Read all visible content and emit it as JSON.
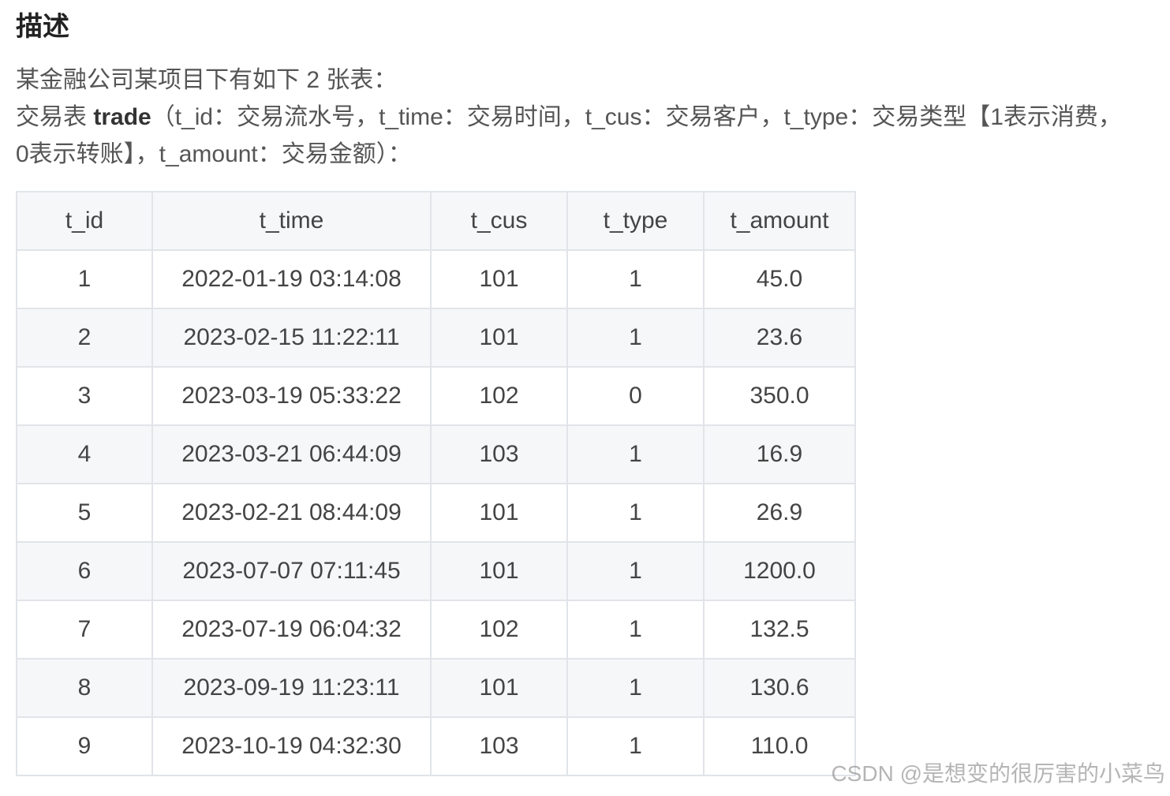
{
  "heading": "描述",
  "intro": {
    "line1": "某金融公司某项目下有如下 2 张表：",
    "line2_prefix": "交易表 ",
    "line2_table": "trade",
    "line2_rest": "（t_id：交易流水号，t_time：交易时间，t_cus：交易客户，t_type：交易类型【1表示消费，",
    "line3": "0表示转账】，t_amount：交易金额）："
  },
  "table": {
    "columns": [
      "t_id",
      "t_time",
      "t_cus",
      "t_type",
      "t_amount"
    ],
    "rows": [
      [
        "1",
        "2022-01-19 03:14:08",
        "101",
        "1",
        "45.0"
      ],
      [
        "2",
        "2023-02-15 11:22:11",
        "101",
        "1",
        "23.6"
      ],
      [
        "3",
        "2023-03-19 05:33:22",
        "102",
        "0",
        "350.0"
      ],
      [
        "4",
        "2023-03-21 06:44:09",
        "103",
        "1",
        "16.9"
      ],
      [
        "5",
        "2023-02-21 08:44:09",
        "101",
        "1",
        "26.9"
      ],
      [
        "6",
        "2023-07-07 07:11:45",
        "101",
        "1",
        "1200.0"
      ],
      [
        "7",
        "2023-07-19 06:04:32",
        "102",
        "1",
        "132.5"
      ],
      [
        "8",
        "2023-09-19 11:23:11",
        "101",
        "1",
        "130.6"
      ],
      [
        "9",
        "2023-10-19 04:32:30",
        "103",
        "1",
        "110.0"
      ]
    ]
  },
  "watermark": "CSDN @是想变的很厉害的小菜鸟"
}
